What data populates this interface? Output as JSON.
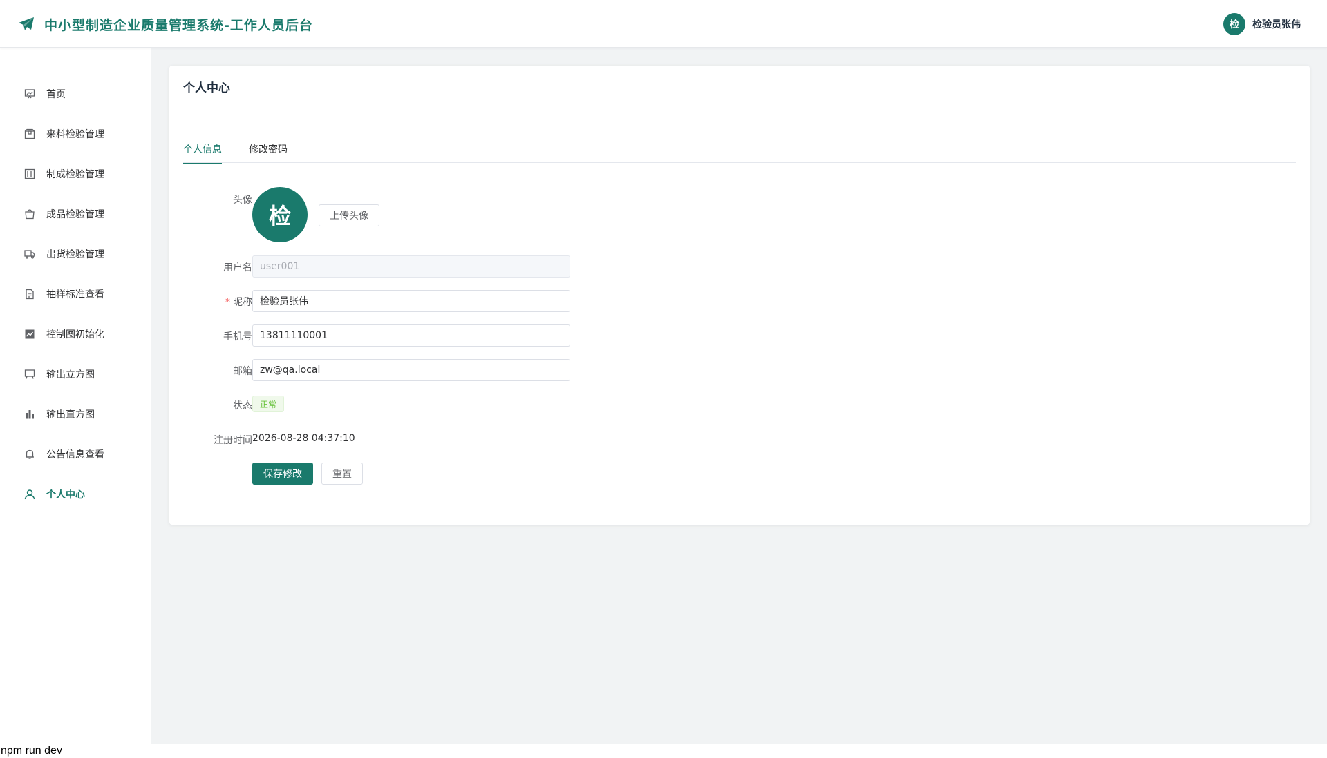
{
  "header": {
    "title": "中小型制造企业质量管理系统-工作人员后台",
    "user_avatar_char": "检",
    "user_name": "检验员张伟",
    "accent_color": "#1a7a6c"
  },
  "sidebar": {
    "items": [
      {
        "label": "首页",
        "icon": "dashboard-icon"
      },
      {
        "label": "来料检验管理",
        "icon": "box-icon"
      },
      {
        "label": "制成检验管理",
        "icon": "list-check-icon"
      },
      {
        "label": "成品检验管理",
        "icon": "bag-icon"
      },
      {
        "label": "出货检验管理",
        "icon": "truck-icon"
      },
      {
        "label": "抽样标准查看",
        "icon": "document-icon"
      },
      {
        "label": "控制图初始化",
        "icon": "line-chart-icon"
      },
      {
        "label": "输出立方图",
        "icon": "board-icon"
      },
      {
        "label": "输出直方图",
        "icon": "bar-chart-icon"
      },
      {
        "label": "公告信息查看",
        "icon": "bell-icon"
      },
      {
        "label": "个人中心",
        "icon": "user-icon",
        "active": true
      }
    ]
  },
  "card": {
    "title": "个人中心",
    "tabs": [
      {
        "label": "个人信息",
        "active": true
      },
      {
        "label": "修改密码",
        "active": false
      }
    ]
  },
  "form": {
    "avatar_label": "头像",
    "avatar_char": "检",
    "upload_button": "上传头像",
    "username_label": "用户名",
    "username_value": "user001",
    "nickname_label": "昵称",
    "nickname_value": "检验员张伟",
    "phone_label": "手机号",
    "phone_value": "13811110001",
    "email_label": "邮箱",
    "email_value": "zw@qa.local",
    "status_label": "状态",
    "status_value": "正常",
    "register_label": "注册时间",
    "register_value": "2026-08-28 04:37:10",
    "save_button": "保存修改",
    "reset_button": "重置"
  },
  "terminal": {
    "text": "npm run dev"
  }
}
